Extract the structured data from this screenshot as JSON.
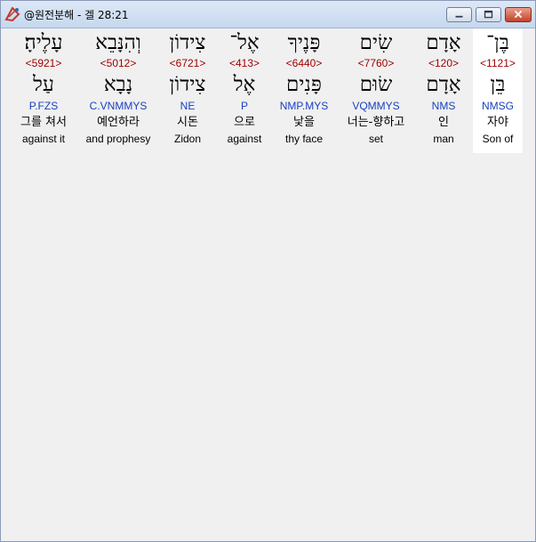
{
  "window": {
    "title": "@원전분해 - 겔 28:21",
    "icon": "app-logo-icon"
  },
  "columns": [
    {
      "hebrew": "בֶּן־",
      "strong": "<1121>",
      "lemma": "בֵּן",
      "morph": "NMSG",
      "korean": "자야",
      "english": "Son of",
      "selected": true
    },
    {
      "hebrew": "אָדָם",
      "strong": "<120>",
      "lemma": "אָדָם",
      "morph": "NMS",
      "korean": "인",
      "english": "man"
    },
    {
      "hebrew": "שִׂים",
      "strong": "<7760>",
      "lemma": "שׂוּם",
      "morph": "VQMMYS",
      "korean": "너는-향하고",
      "english": "set"
    },
    {
      "hebrew": "פָּנֶיךָ",
      "strong": "<6440>",
      "lemma": "פָּנִים",
      "morph": "NMP.MYS",
      "korean": "낯을",
      "english": "thy face"
    },
    {
      "hebrew": "אֶל־",
      "strong": "<413>",
      "lemma": "אֶל",
      "morph": "P",
      "korean": "으로",
      "english": "against"
    },
    {
      "hebrew": "צִידוֹן",
      "strong": "<6721>",
      "lemma": "צִידוֹן",
      "morph": "NE",
      "korean": "시돈",
      "english": "Zidon"
    },
    {
      "hebrew": "וְהִנָּבֵא",
      "strong": "<5012>",
      "lemma": "נָבָא",
      "morph": "C.VNMMYS",
      "korean": "예언하라",
      "english": "and prophesy"
    },
    {
      "hebrew": "עָלֶיהָ׃",
      "strong": "<5921>",
      "lemma": "עַל",
      "morph": "P.FZS",
      "korean": "그를 쳐서",
      "english": "against it"
    }
  ]
}
